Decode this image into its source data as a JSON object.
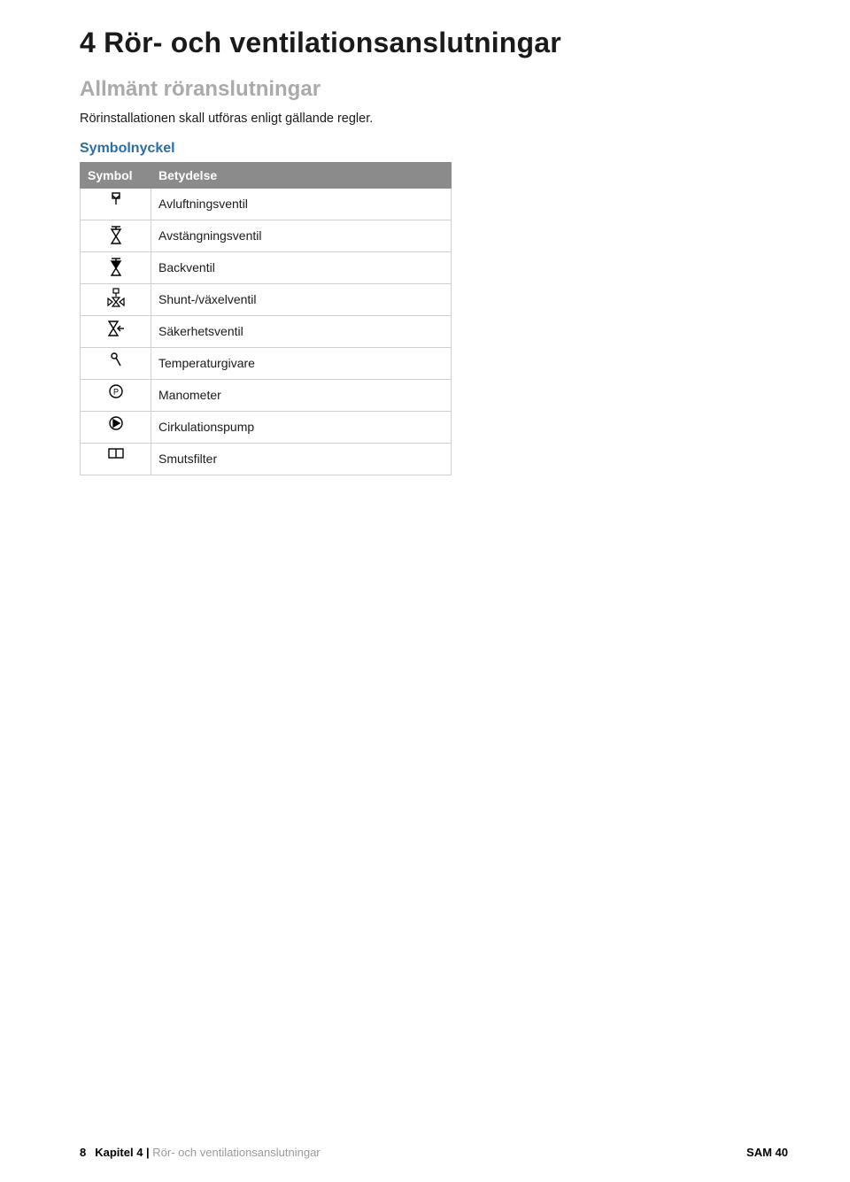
{
  "heading1": "4 Rör- och ventilationsanslutningar",
  "heading2": "Allmänt röranslutningar",
  "paragraph": "Rörinstallationen skall utföras enligt gällande regler.",
  "heading3": "Symbolnyckel",
  "table": {
    "headers": {
      "symbol": "Symbol",
      "meaning": "Betydelse"
    },
    "rows": [
      {
        "icon": "vent-valve-icon",
        "meaning": "Avluftningsventil"
      },
      {
        "icon": "shutoff-valve-icon",
        "meaning": "Avstängningsventil"
      },
      {
        "icon": "check-valve-icon",
        "meaning": "Backventil"
      },
      {
        "icon": "shunt-valve-icon",
        "meaning": "Shunt-/växelventil"
      },
      {
        "icon": "safety-valve-icon",
        "meaning": "Säkerhetsventil"
      },
      {
        "icon": "temp-sensor-icon",
        "meaning": "Temperaturgivare"
      },
      {
        "icon": "manometer-icon",
        "meaning": "Manometer"
      },
      {
        "icon": "pump-icon",
        "meaning": "Cirkulationspump"
      },
      {
        "icon": "filter-icon",
        "meaning": "Smutsfilter"
      }
    ]
  },
  "footer": {
    "page_number": "8",
    "chapter_label": "Kapitel 4 |",
    "chapter_title": "Rör- och ventilationsanslutningar",
    "doc_code": "SAM 40"
  }
}
